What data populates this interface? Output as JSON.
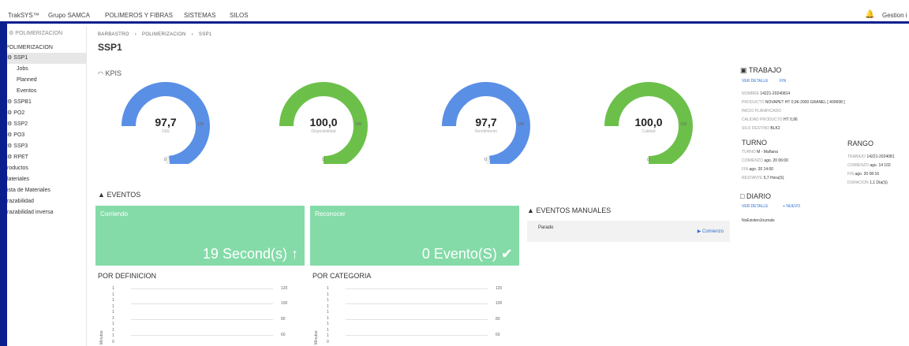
{
  "topbar": {
    "brand": "TrakSYS™",
    "group": "Grupo SAMCA",
    "nav": [
      "POLIMEROS Y FIBRAS",
      "SISTEMAS",
      "SILOS"
    ],
    "user": "Gestion i"
  },
  "sidebar": {
    "header": "POLIMERIZACION",
    "section": "POLIMERIZACION",
    "items": [
      {
        "label": "SSP1",
        "icon": "gear-icon",
        "selected": true
      },
      {
        "label": "Jobs",
        "indent": true
      },
      {
        "label": "Planned",
        "indent": true
      },
      {
        "label": "Eventos",
        "indent": true
      },
      {
        "label": "SSPB1",
        "icon": "gear-icon"
      },
      {
        "label": "PO2",
        "icon": "gear-icon"
      },
      {
        "label": "SSP2",
        "icon": "gear-icon"
      },
      {
        "label": "PO3",
        "icon": "gear-icon"
      },
      {
        "label": "SSP3",
        "icon": "gear-icon"
      },
      {
        "label": "RPET",
        "icon": "gear-icon"
      },
      {
        "label": "roductos"
      },
      {
        "label": "lateriales"
      },
      {
        "label": "ista de Materiales"
      },
      {
        "label": "razabilidad"
      },
      {
        "label": "razabilidad inversa"
      }
    ]
  },
  "breadcrumb": [
    "BARBASTRO",
    "POLIMERIZACION",
    "SSP1"
  ],
  "page_title": "SSP1",
  "kpis": {
    "title": "KPIS",
    "gauges": [
      {
        "value": "97,7",
        "label": "OEE",
        "fraction": 0.977,
        "color": "#5a8fe6",
        "max": "100",
        "min": "0"
      },
      {
        "value": "100,0",
        "label": "Disponibilidad",
        "fraction": 1.0,
        "color": "#6cc04a",
        "max": "100",
        "min": "0"
      },
      {
        "value": "97,7",
        "label": "Rendimiento",
        "fraction": 0.977,
        "color": "#5a8fe6",
        "max": "100",
        "min": "0"
      },
      {
        "value": "100,0",
        "label": "Calidad",
        "fraction": 1.0,
        "color": "#6cc04a",
        "max": "100",
        "min": "0"
      }
    ]
  },
  "eventos": {
    "title": "EVENTOS",
    "cards": [
      {
        "title": "Corriendo",
        "value": "19 Second(s)",
        "icon": "arrow-up-icon"
      },
      {
        "title": "Reconocer",
        "value": "0 Evento(S)",
        "icon": "check-circle-icon"
      }
    ]
  },
  "eventos_manuales": {
    "title": "EVENTOS MANUALES",
    "row_label": "Parado",
    "action": "Comienzo"
  },
  "por_definicion": {
    "title": "POR DEFINICION",
    "ylabel": "Minutos",
    "ticks": [
      "120",
      "100",
      "80",
      "60"
    ],
    "row_values": [
      "1",
      "1",
      "1",
      "1",
      "1",
      "1",
      "1",
      "1",
      "1",
      "0"
    ]
  },
  "por_categoria": {
    "title": "POR CATEGORIA",
    "ylabel": "Minutos",
    "ticks": [
      "120",
      "100",
      "80",
      "60"
    ],
    "row_values": [
      "1",
      "1",
      "1",
      "1",
      "1",
      "1",
      "1",
      "1",
      "1",
      "0"
    ]
  },
  "trabajo": {
    "title": "TRABAJO",
    "link_detail": "VER DETALLE",
    "link_end": "FIN",
    "nombre_label": "NOMBRE",
    "nombre": "14221-20240814",
    "producto_label": "PRODUCTO",
    "producto": "NOVAPET HT 0,96-2000 GRANEL [ 400698 ]",
    "inicio_label": "INICIO PLANIFICADO",
    "calidad_label": "CALIDAD PRODUCTO",
    "calidad": "HT 0,96",
    "silo_label": "SILO DESTINO",
    "silo": "BLK2"
  },
  "turno": {
    "title": "TURNO",
    "turno_label": "TURNO",
    "turno": "M - Mañana",
    "comienzo_label": "COMIENZO",
    "comienzo": "ago. 20 06:00",
    "fin_label": "FIN",
    "fin": "ago. 20 14:00",
    "restante_label": "RESTANTE",
    "restante": "5,7 Hora(S)"
  },
  "rango": {
    "title": "RANGO",
    "trabajo_label": "TRABAJO",
    "trabajo": "14221-2024081",
    "comienzo_label": "COMIENZO",
    "comienzo": "ago. 14 102",
    "fin_label": "FIN",
    "fin": "ago. 20 08:16",
    "duracion_label": "DURACION",
    "duracion": "1,1 Día(S)"
  },
  "diario": {
    "title": "DIARIO",
    "link_detail": "VER DETALLE",
    "link_new": "NUEVO",
    "empty": "NoExistenJournals"
  }
}
